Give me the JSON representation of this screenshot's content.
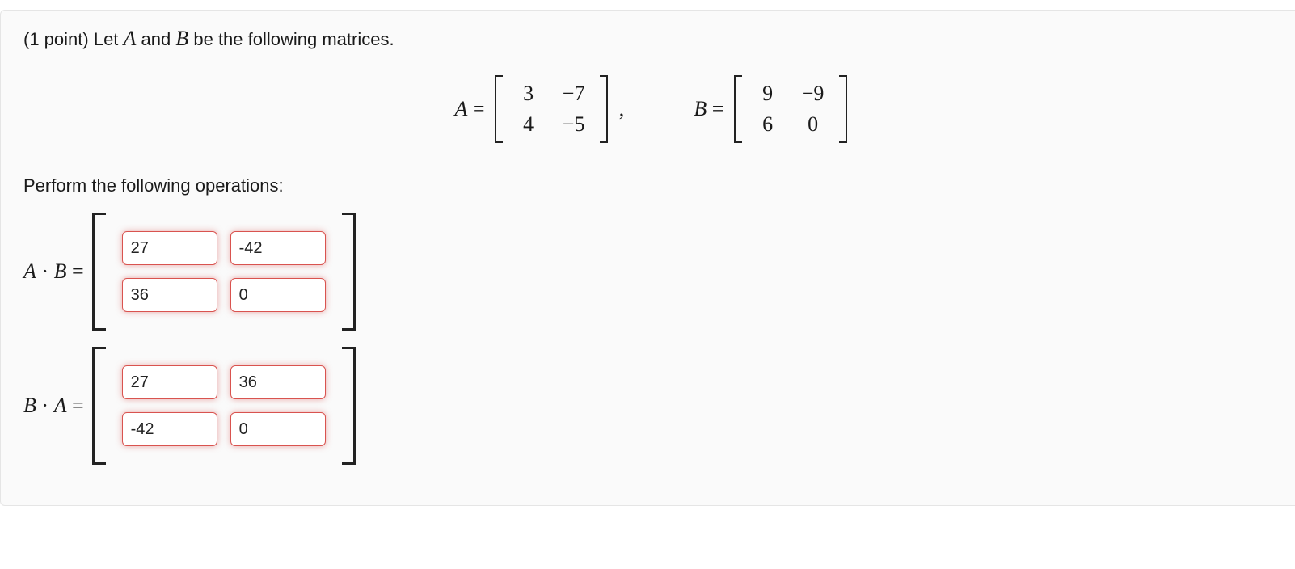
{
  "intro": {
    "points": "(1 point) ",
    "text_before": "Let ",
    "A": "A",
    "and": " and ",
    "B": "B",
    "text_after": " be the following matrices."
  },
  "matrices": {
    "A_label": "A =",
    "A": [
      [
        "3",
        "−7"
      ],
      [
        "4",
        "−5"
      ]
    ],
    "comma": ",",
    "B_label": "B =",
    "B": [
      [
        "9",
        "−9"
      ],
      [
        "6",
        "0"
      ]
    ]
  },
  "perform": "Perform the following operations:",
  "answers": {
    "AB": {
      "label_html": "A · B =",
      "cells": [
        [
          "27",
          "-42"
        ],
        [
          "36",
          "0"
        ]
      ]
    },
    "BA": {
      "label_html": "B · A =",
      "cells": [
        [
          "27",
          "36"
        ],
        [
          "-42",
          "0"
        ]
      ]
    }
  }
}
